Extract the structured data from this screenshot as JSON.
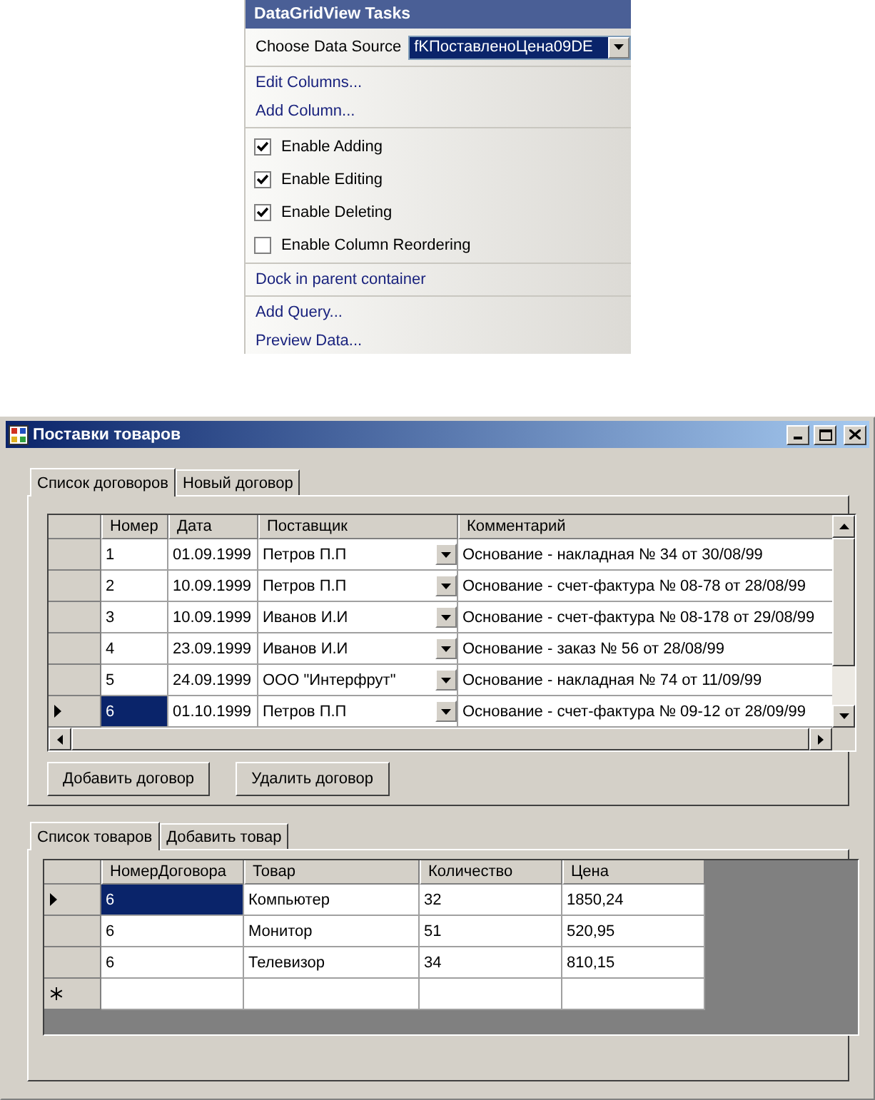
{
  "tasks_panel": {
    "title": "DataGridView Tasks",
    "sections": [
      {
        "items": [
          {
            "kind": "source",
            "label": "Choose Data Source",
            "value": "fKПоставленоЦена09DE"
          }
        ]
      },
      {
        "items": [
          {
            "kind": "link",
            "label": "Edit Columns..."
          },
          {
            "kind": "link",
            "label": "Add Column..."
          }
        ]
      },
      {
        "items": [
          {
            "kind": "checkbox",
            "label": "Enable Adding",
            "checked": true
          },
          {
            "kind": "checkbox",
            "label": "Enable Editing",
            "checked": true
          },
          {
            "kind": "checkbox",
            "label": "Enable Deleting",
            "checked": true
          },
          {
            "kind": "checkbox",
            "label": "Enable Column Reordering",
            "checked": false
          }
        ]
      },
      {
        "items": [
          {
            "kind": "link",
            "label": "Dock in parent container"
          }
        ]
      },
      {
        "items": [
          {
            "kind": "link",
            "label": "Add Query..."
          },
          {
            "kind": "link",
            "label": "Preview Data..."
          }
        ]
      }
    ]
  },
  "window": {
    "title": "Поставки товаров",
    "top_tabs": [
      {
        "label": "Список договоров",
        "selected": true
      },
      {
        "label": "Новый договор",
        "selected": false
      }
    ],
    "contracts_grid": {
      "columns": [
        {
          "label": "Номер",
          "kind": "text"
        },
        {
          "label": "Дата",
          "kind": "text"
        },
        {
          "label": "Поставщик",
          "kind": "combo"
        },
        {
          "label": "Комментарий",
          "kind": "text"
        }
      ],
      "rows": [
        {
          "selected": false,
          "cells": [
            "1",
            "01.09.1999",
            "Петров П.П",
            "Основание - накладная № 34 от 30/08/99"
          ]
        },
        {
          "selected": false,
          "cells": [
            "2",
            "10.09.1999",
            "Петров П.П",
            "Основание - счет-фактура № 08-78 от 28/08/99"
          ]
        },
        {
          "selected": false,
          "cells": [
            "3",
            "10.09.1999",
            "Иванов И.И",
            "Основание - счет-фактура № 08-178 от 29/08/99"
          ]
        },
        {
          "selected": false,
          "cells": [
            "4",
            "23.09.1999",
            "Иванов И.И",
            "Основание - заказ № 56 от 28/08/99"
          ]
        },
        {
          "selected": false,
          "cells": [
            "5",
            "24.09.1999",
            "ООО \"Интерфрут\"",
            "Основание - накладная № 74 от 11/09/99"
          ]
        },
        {
          "selected": true,
          "cells": [
            "6",
            "01.10.1999",
            "Петров П.П",
            "Основание - счет-фактура № 09-12 от 28/09/99"
          ]
        }
      ]
    },
    "buttons": [
      "Добавить договор",
      "Удалить договор"
    ],
    "bottom_tabs": [
      {
        "label": "Список товаров",
        "selected": true
      },
      {
        "label": "Добавить товар",
        "selected": false
      }
    ],
    "goods_grid": {
      "columns": [
        {
          "label": "НомерДоговора"
        },
        {
          "label": "Товар"
        },
        {
          "label": "Количество"
        },
        {
          "label": "Цена"
        }
      ],
      "rows": [
        {
          "selected": true,
          "cells": [
            "6",
            "Компьютер",
            "32",
            "1850,24"
          ]
        },
        {
          "selected": false,
          "cells": [
            "6",
            "Монитор",
            "51",
            "520,95"
          ]
        },
        {
          "selected": false,
          "cells": [
            "6",
            "Телевизор",
            "34",
            "810,15"
          ]
        }
      ],
      "new_row": true
    }
  }
}
